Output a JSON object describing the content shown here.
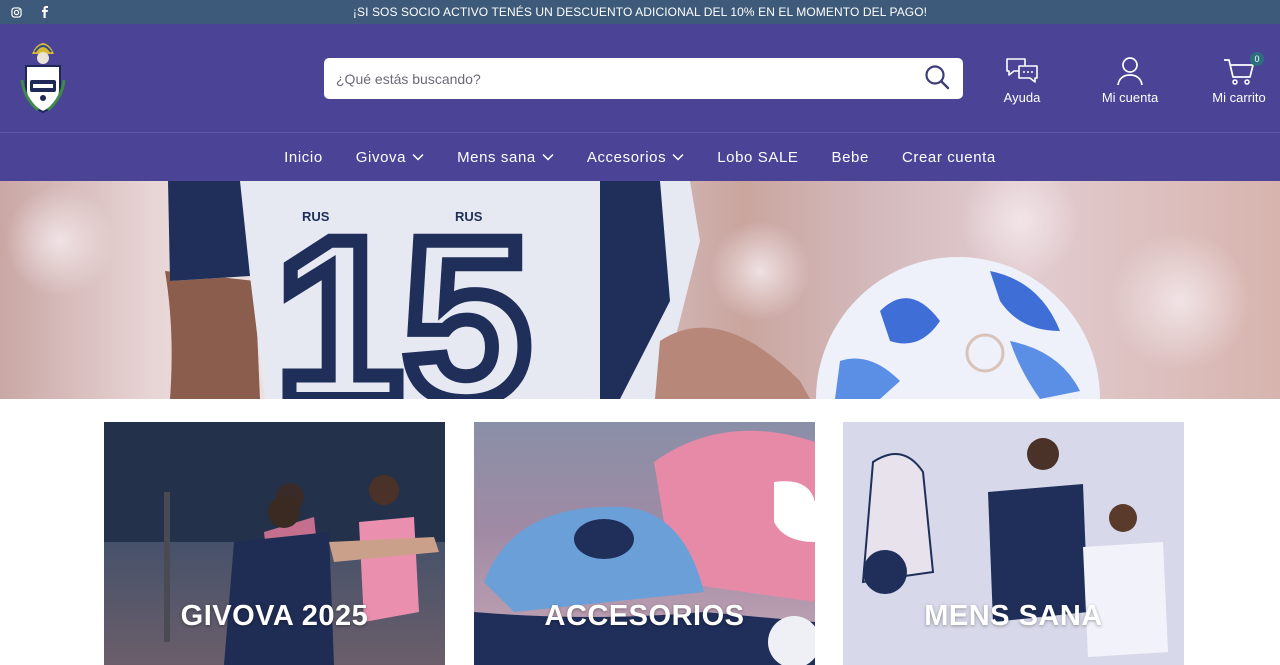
{
  "topbar": {
    "announcement": "¡SI SOS SOCIO ACTIVO TENÉS UN DESCUENTO ADICIONAL DEL 10% EN EL MOMENTO DEL PAGO!",
    "social_icons": [
      "instagram-icon",
      "facebook-icon"
    ]
  },
  "header": {
    "search": {
      "placeholder": "¿Qué estás buscando?",
      "value": ""
    },
    "help_label": "Ayuda",
    "account_label": "Mi cuenta",
    "cart_label": "Mi carrito",
    "cart_count": "0"
  },
  "nav": {
    "items": [
      {
        "label": "Inicio",
        "has_dropdown": false
      },
      {
        "label": "Givova",
        "has_dropdown": true
      },
      {
        "label": "Mens sana",
        "has_dropdown": true
      },
      {
        "label": "Accesorios",
        "has_dropdown": true
      },
      {
        "label": "Lobo SALE",
        "has_dropdown": false
      },
      {
        "label": "Bebe",
        "has_dropdown": false
      },
      {
        "label": "Crear cuenta",
        "has_dropdown": false
      }
    ]
  },
  "hero": {
    "jersey_number": "15",
    "sponsor_text": "RUS"
  },
  "categories": [
    {
      "title": "GIVOVA 2025"
    },
    {
      "title": "ACCESORIOS"
    },
    {
      "title": "MENS SANA"
    }
  ],
  "colors": {
    "topbar_bg": "#3d5a7a",
    "header_bg": "#4a4396",
    "text_on_dark": "#ffffff"
  }
}
